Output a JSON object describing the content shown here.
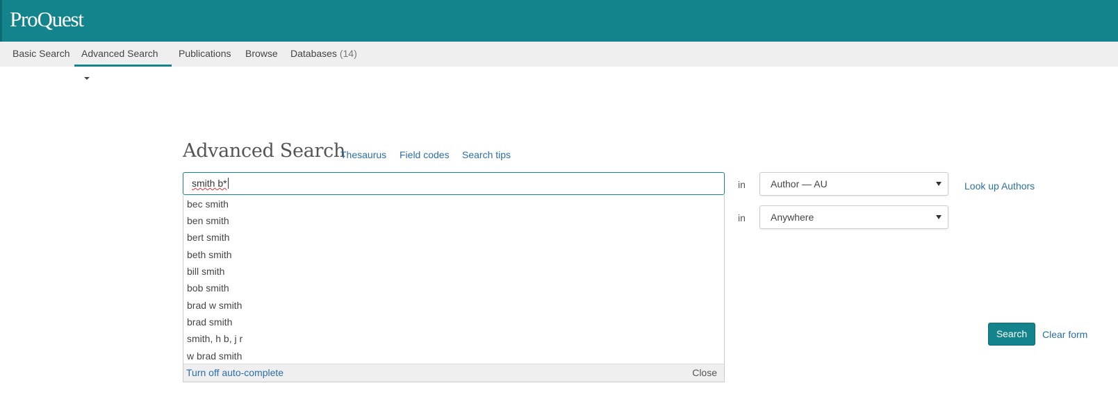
{
  "brand": {
    "logo": "ProQuest",
    "color": "#13848c"
  },
  "nav": {
    "items": [
      {
        "label": "Basic Search"
      },
      {
        "label": "Advanced Search",
        "active": true
      },
      {
        "label": "Publications"
      },
      {
        "label": "Browse"
      },
      {
        "label": "Databases",
        "count": "(14)"
      }
    ]
  },
  "page": {
    "title": "Advanced Search",
    "links": {
      "thesaurus": "Thesaurus",
      "field_codes": "Field codes",
      "search_tips": "Search tips"
    }
  },
  "search": {
    "row1": {
      "value": "smith b*",
      "in_label": "in",
      "field": "Author — AU",
      "lookup": "Look up Authors"
    },
    "row2": {
      "in_label": "in",
      "field": "Anywhere"
    }
  },
  "autocomplete": {
    "suggestions": [
      "bec smith",
      "ben smith",
      "bert smith",
      "beth smith",
      "bill smith",
      "bob smith",
      "brad w smith",
      "brad smith",
      "smith, h b, j r",
      "w brad smith"
    ],
    "turn_off": "Turn off auto-complete",
    "close": "Close"
  },
  "actions": {
    "search": "Search",
    "clear": "Clear form"
  },
  "icons": {
    "dropdown_caret": "caret-down-icon",
    "select_arrow": "select-arrow-icon"
  }
}
